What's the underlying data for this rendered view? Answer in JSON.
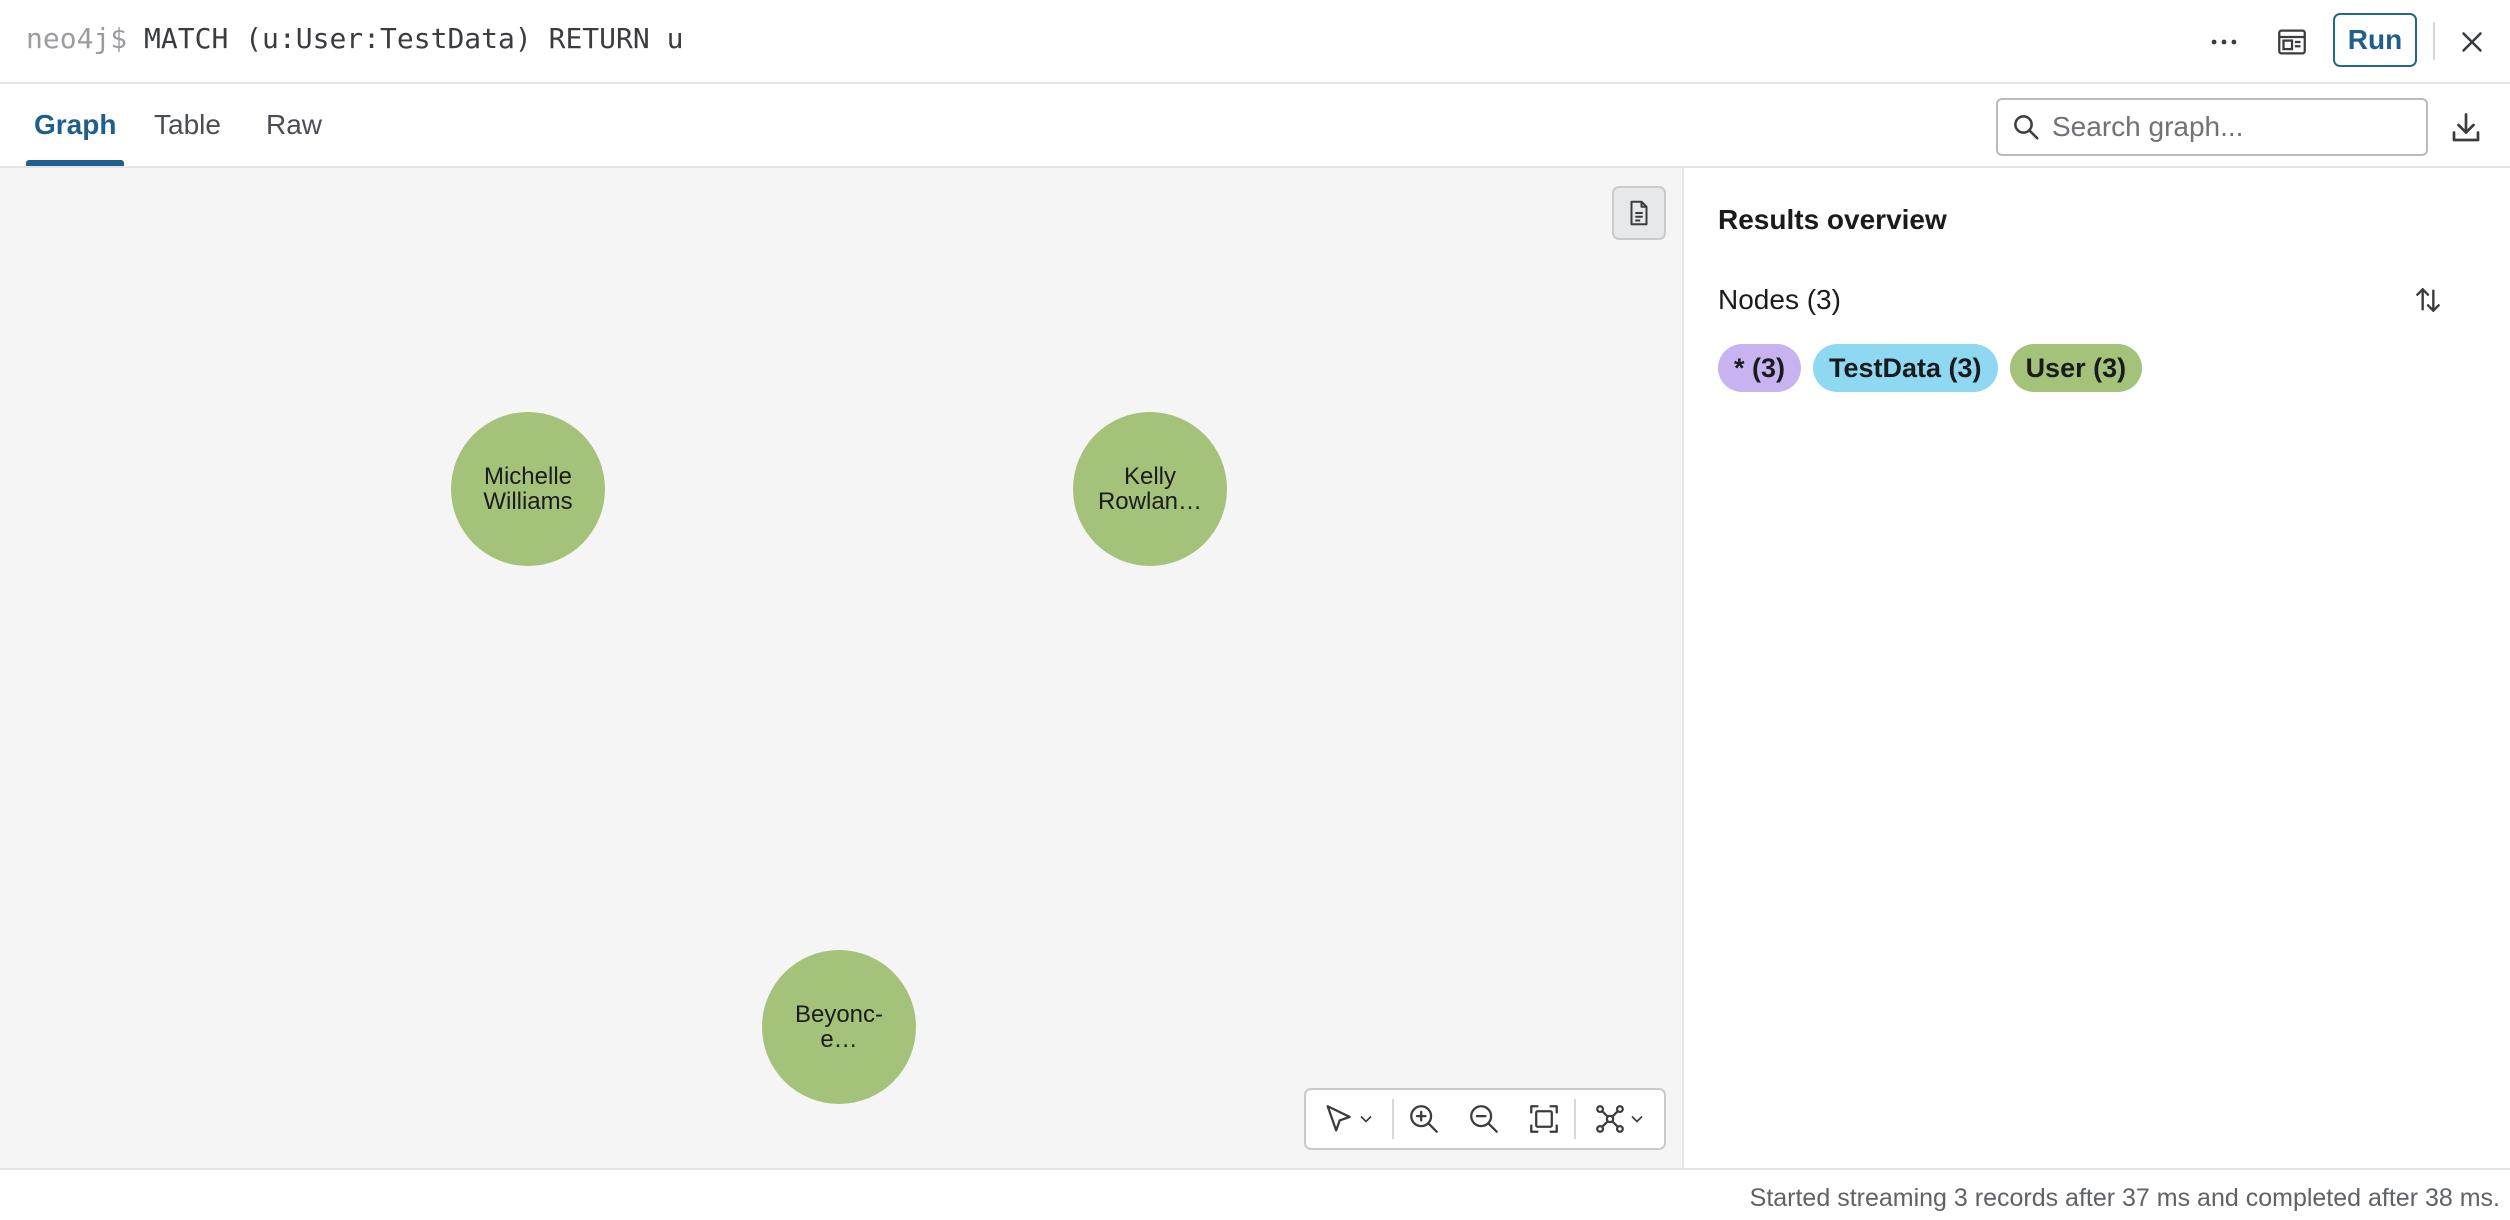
{
  "query": {
    "prompt": "neo4j$",
    "text": "MATCH (u:User:TestData) RETURN u",
    "run_label": "Run",
    "icons": [
      "more-icon",
      "pin-panel-icon",
      "close-icon"
    ]
  },
  "tabs": [
    {
      "label": "Graph",
      "active": true
    },
    {
      "label": "Table",
      "active": false
    },
    {
      "label": "Raw",
      "active": false
    }
  ],
  "search": {
    "placeholder": "Search graph..."
  },
  "graph": {
    "nodes": [
      {
        "label": "Michelle\nWilliams",
        "color": "#a5c27b"
      },
      {
        "label": "Kelly\nRowlan…",
        "color": "#a5c27b"
      },
      {
        "label": "Beyonc-\ne…",
        "color": "#a5c27b"
      }
    ],
    "toolbar_icons": [
      "select-pointer-icon",
      "zoom-in-icon",
      "zoom-out-icon",
      "fit-to-screen-icon",
      "layout-icon"
    ]
  },
  "overview": {
    "title": "Results overview",
    "nodes_label": "Nodes (3)",
    "chips": [
      {
        "label": "* (3)",
        "color": "#c8b2ef"
      },
      {
        "label": "TestData (3)",
        "color": "#8fd8f2"
      },
      {
        "label": "User (3)",
        "color": "#a5c27b"
      }
    ]
  },
  "status": {
    "text": "Started streaming 3 records after 37 ms and completed after 38 ms."
  },
  "colors": {
    "accent": "#1f5f8d",
    "node": "#a5c27b",
    "canvas": "#f5f5f5"
  }
}
